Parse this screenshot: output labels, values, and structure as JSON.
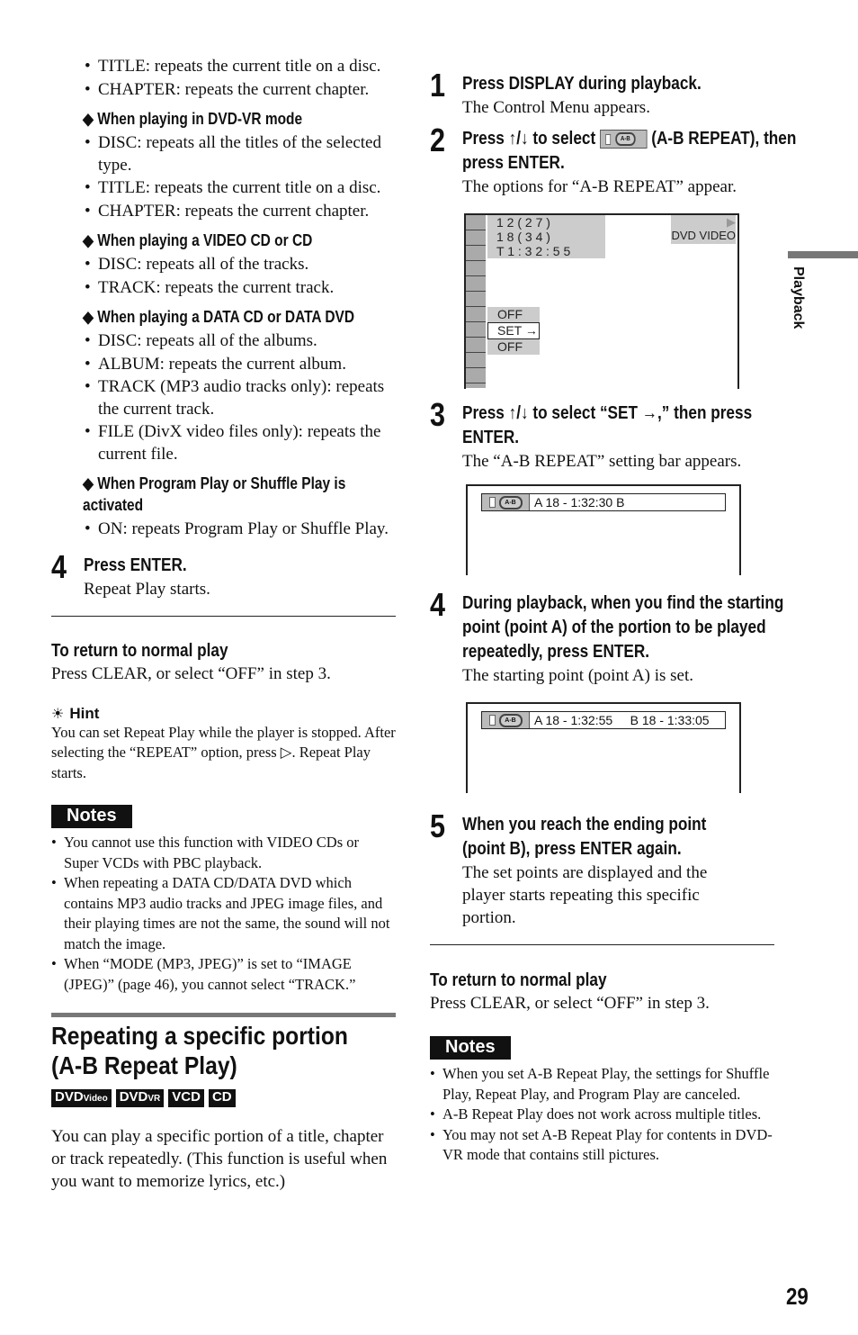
{
  "left": {
    "intro_bullets": [
      "TITLE: repeats the current title on a disc.",
      "CHAPTER: repeats the current chapter."
    ],
    "groups": [
      {
        "heading": "◆ When playing in DVD-VR mode",
        "bullets": [
          "DISC: repeats all the titles of the selected type.",
          "TITLE: repeats the current title on a disc.",
          "CHAPTER: repeats the current chapter."
        ]
      },
      {
        "heading": "◆ When playing a VIDEO CD or CD",
        "bullets": [
          "DISC: repeats all of the tracks.",
          "TRACK: repeats the current track."
        ]
      },
      {
        "heading": "◆ When playing a DATA CD or DATA DVD",
        "bullets": [
          "DISC: repeats all of the albums.",
          "ALBUM: repeats the current album.",
          "TRACK (MP3 audio tracks only): repeats the current track.",
          "FILE (DivX video files only): repeats the current file."
        ]
      },
      {
        "heading": "◆ When Program Play or Shuffle Play is activated",
        "bullets": [
          "ON: repeats Program Play or Shuffle Play."
        ]
      }
    ],
    "step4": {
      "num": "4",
      "head": "Press ENTER.",
      "text": "Repeat Play starts."
    },
    "return": {
      "heading": "To return to normal play",
      "text": "Press CLEAR, or select “OFF” in step 3."
    },
    "hint": {
      "label": "Hint",
      "text": "You can set Repeat Play while the player is stopped. After selecting the “REPEAT” option, press ▷. Repeat Play starts."
    },
    "notes": {
      "label": "Notes",
      "items": [
        "You cannot use this function with VIDEO CDs or Super VCDs with PBC playback.",
        "When repeating a DATA CD/DATA DVD which contains MP3 audio tracks and JPEG image files, and their playing times are not the same, the sound will not match the image.",
        "When “MODE (MP3, JPEG)” is set to “IMAGE (JPEG)” (page 46), you cannot select “TRACK.”"
      ]
    },
    "section": {
      "title": "Repeating a specific portion (A-B Repeat Play)",
      "badges": [
        {
          "main": "DVD",
          "sub": "Video"
        },
        {
          "main": "DVD",
          "sub": "VR"
        },
        {
          "main": "VCD",
          "sub": ""
        },
        {
          "main": "CD",
          "sub": ""
        }
      ],
      "intro": "You can play a specific portion of a title, chapter or track repeatedly. (This function is useful when you want to memorize lyrics, etc.)"
    }
  },
  "right": {
    "step1": {
      "num": "1",
      "head": "Press DISPLAY during playback.",
      "text": "The Control Menu appears."
    },
    "step2": {
      "num": "2",
      "head_a": "Press ↑/↓ to select",
      "head_b": "(A-B REPEAT), then press ENTER.",
      "text": "The options for “A-B REPEAT” appear."
    },
    "osd1": {
      "line1": "1 2 ( 2 7 )",
      "line2": "1 8 ( 3 4 )",
      "line3": "T     1 : 3 2 : 5 5",
      "disc_type": "DVD VIDEO",
      "options": [
        "OFF",
        "SET →",
        "OFF"
      ]
    },
    "step3": {
      "num": "3",
      "head": "Press ↑/↓ to select “SET →,” then press ENTER.",
      "text": "The “A-B REPEAT” setting bar appears."
    },
    "bar1": {
      "text": "A 18 - 1:32:30     B"
    },
    "step4": {
      "num": "4",
      "head": "During playback, when you find the starting point (point A) of the portion to be played repeatedly, press ENTER.",
      "text": "The starting point (point A) is set."
    },
    "bar2": {
      "text": "A 18 - 1:32:55     B 18 - 1:33:05"
    },
    "step5": {
      "num": "5",
      "head": "When you reach the ending point (point B), press ENTER again.",
      "text": "The set points are displayed and the player starts repeating this specific portion."
    },
    "return": {
      "heading": "To return to normal play",
      "text": "Press CLEAR, or select “OFF” in step 3."
    },
    "notes": {
      "label": "Notes",
      "items": [
        "When you set A-B Repeat Play, the settings for Shuffle Play, Repeat Play, and Program Play are canceled.",
        "A-B Repeat Play does not work across multiple titles.",
        "You may not set A-B Repeat Play for contents in DVD-VR mode that contains still pictures."
      ]
    }
  },
  "side_tab": "Playback",
  "page_number": "29"
}
